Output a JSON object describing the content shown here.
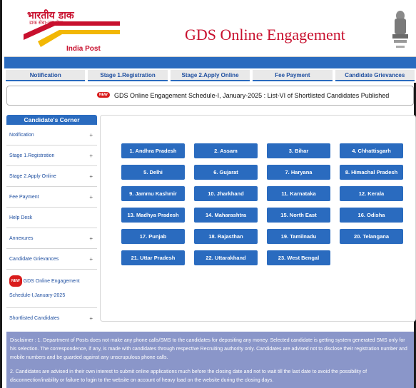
{
  "header": {
    "logo_hindi": "भारतीय डाक",
    "logo_hindi_sub": "डाक सेवा-जन सेवा",
    "logo_text": "India Post",
    "title": "GDS Online Engagement"
  },
  "nav": {
    "items": [
      {
        "label": "Notification"
      },
      {
        "label": "Stage 1.Registration"
      },
      {
        "label": "Stage 2.Apply Online"
      },
      {
        "label": "Fee Payment"
      },
      {
        "label": "Candidate Grievances"
      }
    ]
  },
  "notice": {
    "badge": "NEW",
    "text": "GDS Online Engagement Schedule-I, January-2025 : List-VI of Shortlisted Candidates Published"
  },
  "sidebar": {
    "heading": "Candidate's Corner",
    "items": [
      {
        "label": "Notification",
        "plus": "+"
      },
      {
        "label": "Stage 1.Registration",
        "plus": "+"
      },
      {
        "label": "Stage 2.Apply Online",
        "plus": "+"
      },
      {
        "label": "Fee Payment",
        "plus": "+"
      },
      {
        "label": "Help Desk",
        "plus": ""
      },
      {
        "label": "Annexures",
        "plus": "+"
      },
      {
        "label": "Candidate Grievances",
        "plus": "+"
      }
    ],
    "promo": {
      "badge": "NEW",
      "line1": "GDS Online Engagement",
      "line2": "Schedule-I,January-2025"
    },
    "last": {
      "label": "Shortlisted Candidates",
      "plus": "+"
    }
  },
  "states": [
    "1. Andhra Pradesh",
    "2. Assam",
    "3. Bihar",
    "4. Chhattisgarh",
    "5. Delhi",
    "6. Gujarat",
    "7. Haryana",
    "8. Himachal Pradesh",
    "9. Jammu Kashmir",
    "10. Jharkhand",
    "11. Karnataka",
    "12. Kerala",
    "13. Madhya Pradesh",
    "14. Maharashtra",
    "15. North East",
    "16. Odisha",
    "17. Punjab",
    "18. Rajasthan",
    "19. Tamilnadu",
    "20. Telangana",
    "21. Uttar Pradesh",
    "22. Uttarakhand",
    "23. West Bengal"
  ],
  "disclaimer": {
    "p1": "Disclaimer : 1. Department of Posts does not make any phone calls/SMS to the candidates for depositing any money. Selected candidate is getting system generated SMS only for his selection. The correspondence, if any, is made with candidates through respective Recruiting authority only. Candidates are advised not to disclose their registration number and mobile numbers and be guarded against any unscrupulous phone calls.",
    "p2": "2. Candidates are advised in their own interest to submit online applications much before the closing date and not to wait till the last date to avoid the possibility of disconnection/inability or failure to login to the website on account of heavy load on the website during the closing days."
  },
  "colors": {
    "primary": "#2a6bbf",
    "brand_red": "#c8102e",
    "disclaimer_bg": "#8a96c9"
  }
}
